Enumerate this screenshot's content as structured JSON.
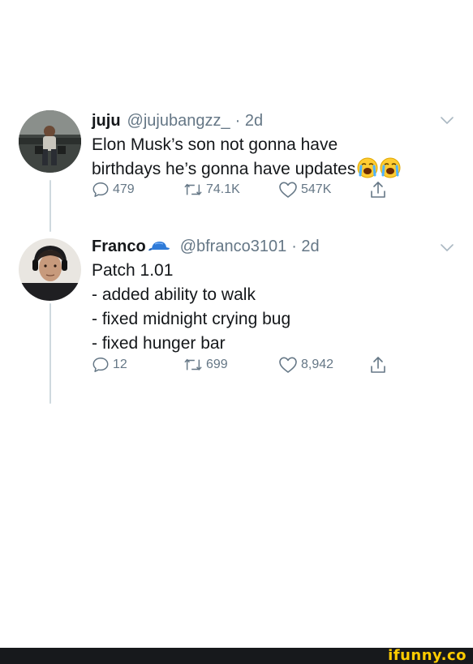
{
  "tweets": [
    {
      "name": "juju",
      "handle": "@jujubangzz_",
      "time": "· 2d",
      "text_lines": [
        "Elon Musk’s son not gonna have",
        "birthdays he’s gonna have updates"
      ],
      "emojis": [
        "loudly-crying-face",
        "loudly-crying-face"
      ],
      "replies": "479",
      "retweets": "74.1K",
      "likes": "547K"
    },
    {
      "name": "Franco",
      "name_badge_icon": "blue-cap-icon",
      "handle": "@bfranco3101",
      "time": "· 2d",
      "text_lines": [
        "Patch 1.01",
        "- added ability to walk",
        "- fixed midnight crying bug",
        "- fixed hunger bar"
      ],
      "replies": "12",
      "retweets": "699",
      "likes": "8,942"
    }
  ],
  "watermark": "ifunny.co",
  "colors": {
    "text": "#14171a",
    "secondary": "#657786",
    "thread_line": "#cfd9de",
    "footer": "#17191c",
    "watermark": "#ffcc00"
  }
}
